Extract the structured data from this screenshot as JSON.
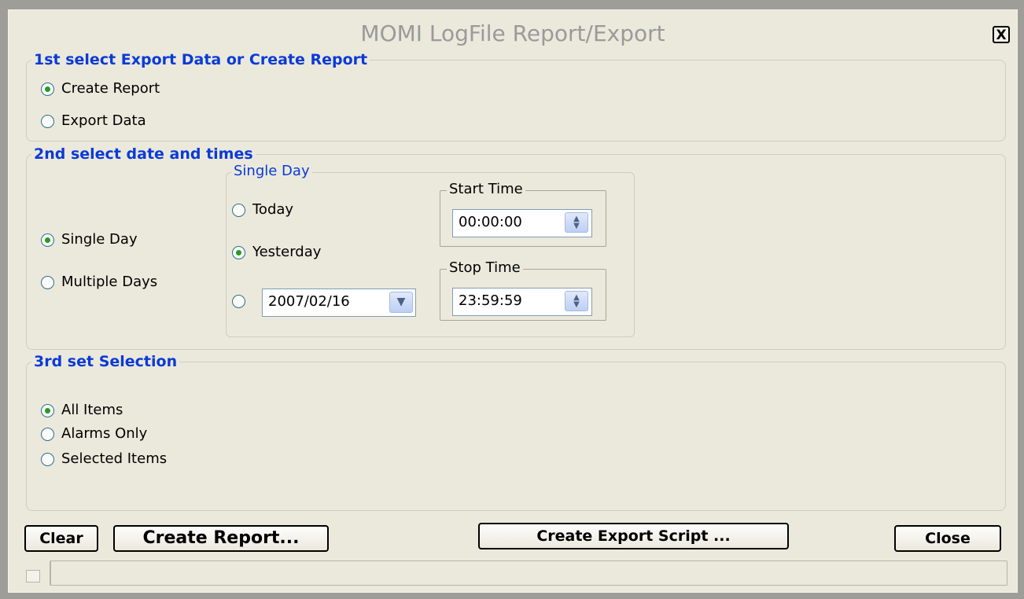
{
  "window": {
    "title": "MOMI LogFile Report/Export",
    "close_label": "X"
  },
  "section1": {
    "title": "1st select Export Data or Create Report",
    "options": [
      {
        "label": "Create Report",
        "checked": true
      },
      {
        "label": "Export Data",
        "checked": false
      }
    ]
  },
  "section2": {
    "title": "2nd select date and times",
    "range_options": [
      {
        "label": "Single Day",
        "checked": true
      },
      {
        "label": "Multiple Days",
        "checked": false
      }
    ],
    "single_day": {
      "title": "Single Day",
      "options": [
        {
          "label": "Today",
          "checked": false
        },
        {
          "label": "Yesterday",
          "checked": true
        }
      ],
      "date_value": "2007/02/16"
    },
    "start_time": {
      "title": "Start Time",
      "value": "00:00:00"
    },
    "stop_time": {
      "title": "Stop Time",
      "value": "23:59:59"
    }
  },
  "section3": {
    "title": "3rd set Selection",
    "options": [
      {
        "label": "All Items",
        "checked": true
      },
      {
        "label": "Alarms Only",
        "checked": false
      },
      {
        "label": "Selected Items",
        "checked": false
      }
    ]
  },
  "buttons": {
    "clear": "Clear",
    "create_report": "Create Report...",
    "create_export_script": "Create Export Script ...",
    "close": "Close"
  },
  "icons": {
    "radio_checked_color": "#239c22",
    "accent_color": "#0a3ad8"
  }
}
